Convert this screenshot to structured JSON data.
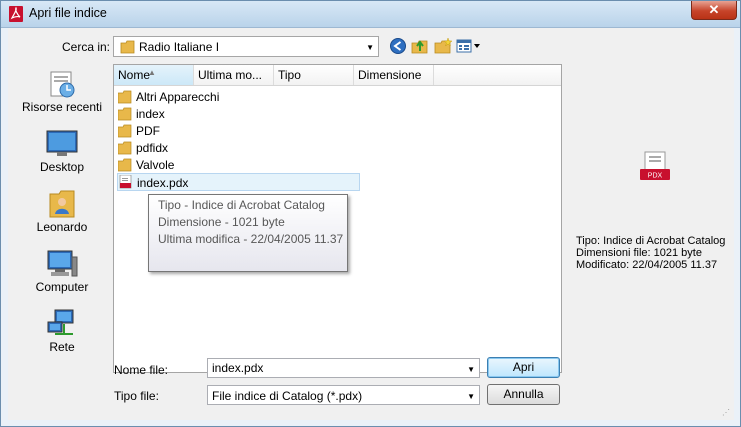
{
  "window": {
    "title": "Apri file indice",
    "close_glyph": "✕"
  },
  "toolbar": {
    "look_in_label": "Cerca in:",
    "look_in_value": "Radio Italiane I",
    "icons": [
      "back-icon",
      "up-folder-icon",
      "new-folder-icon",
      "views-menu-icon"
    ]
  },
  "places": [
    {
      "label": "Risorse recenti",
      "icon": "recent-places-icon"
    },
    {
      "label": "Desktop",
      "icon": "desktop-icon"
    },
    {
      "label": "Leonardo",
      "icon": "user-folder-icon"
    },
    {
      "label": "Computer",
      "icon": "computer-icon"
    },
    {
      "label": "Rete",
      "icon": "network-icon"
    }
  ],
  "columns": [
    "Nome",
    "Ultima mo...",
    "Tipo",
    "Dimensione"
  ],
  "files": [
    {
      "name": "Altri Apparecchi",
      "kind": "folder"
    },
    {
      "name": "index",
      "kind": "folder"
    },
    {
      "name": "PDF",
      "kind": "folder"
    },
    {
      "name": "pdfidx",
      "kind": "folder"
    },
    {
      "name": "Valvole",
      "kind": "folder"
    },
    {
      "name": "index.pdx",
      "kind": "pdx-file",
      "selected": true
    }
  ],
  "tooltip": {
    "type": "Tipo - Indice di Acrobat Catalog",
    "size": "Dimensione - 1021 byte",
    "modified": "Ultima modifica - 22/04/2005 11.37"
  },
  "preview": {
    "icon_label": "PDX",
    "type": "Tipo: Indice di Acrobat Catalog",
    "size": "Dimensioni file: 1021 byte",
    "modified": "Modificato: 22/04/2005 11.37"
  },
  "form": {
    "filename_label": "Nome file:",
    "filename_value": "index.pdx",
    "filetype_label": "Tipo file:",
    "filetype_value": "File indice di Catalog (*.pdx)"
  },
  "buttons": {
    "open": "Apri",
    "cancel": "Annulla"
  },
  "colors": {
    "accent": "#3c7fb1",
    "folder": "#e8b84a",
    "pdf_red": "#c8102e"
  }
}
